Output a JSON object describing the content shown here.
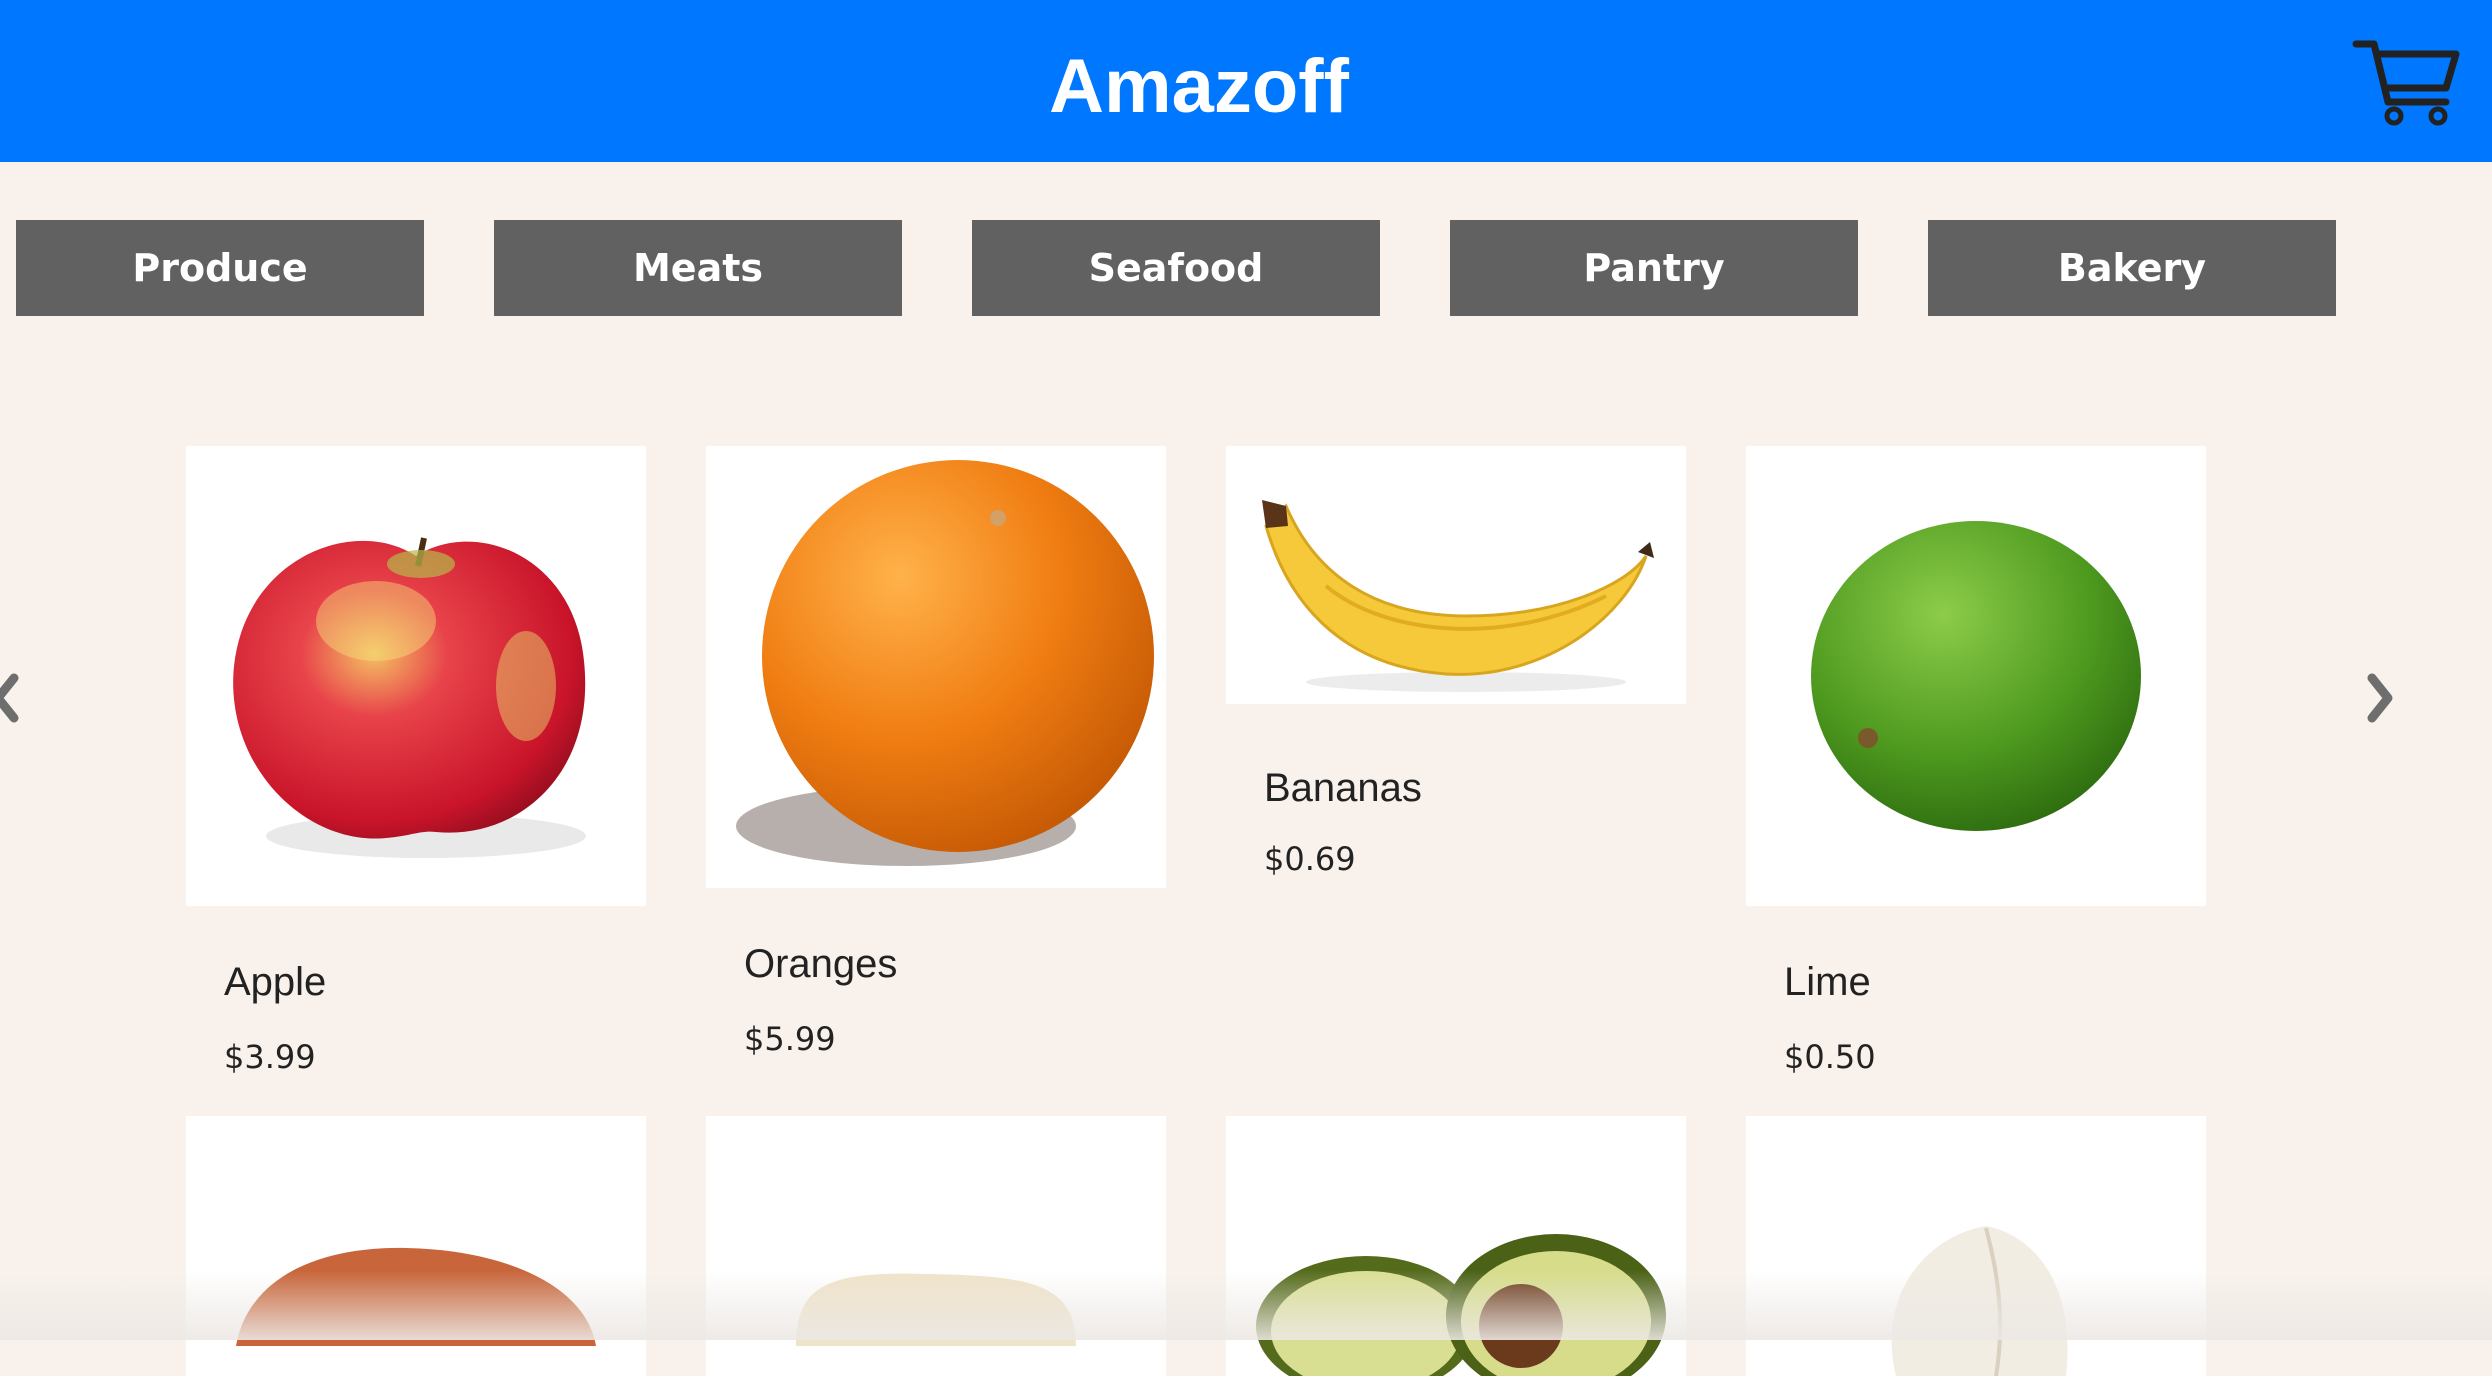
{
  "header": {
    "title": "Amazoff",
    "cart_icon": "shopping-cart-icon"
  },
  "categories": [
    {
      "label": "Produce"
    },
    {
      "label": "Meats"
    },
    {
      "label": "Seafood"
    },
    {
      "label": "Pantry"
    },
    {
      "label": "Bakery"
    }
  ],
  "carousel": {
    "prev_icon": "chevron-left-icon",
    "next_icon": "chevron-right-icon"
  },
  "products": [
    {
      "name": "Apple",
      "price": "$3.99",
      "image_icon": "apple-icon"
    },
    {
      "name": "Oranges",
      "price": "$5.99",
      "image_icon": "orange-icon"
    },
    {
      "name": "Bananas",
      "price": "$0.69",
      "image_icon": "banana-icon"
    },
    {
      "name": "Lime",
      "price": "$0.50",
      "image_icon": "lime-icon"
    }
  ],
  "products_row2": [
    {
      "image_icon": "sweet-potato-icon"
    },
    {
      "image_icon": "squash-icon"
    },
    {
      "image_icon": "avocado-icon"
    },
    {
      "image_icon": "garlic-icon"
    }
  ],
  "colors": {
    "header_bg": "#0077ff",
    "page_bg": "#f9f2ec",
    "category_button_bg": "#616161",
    "text": "#222222"
  }
}
